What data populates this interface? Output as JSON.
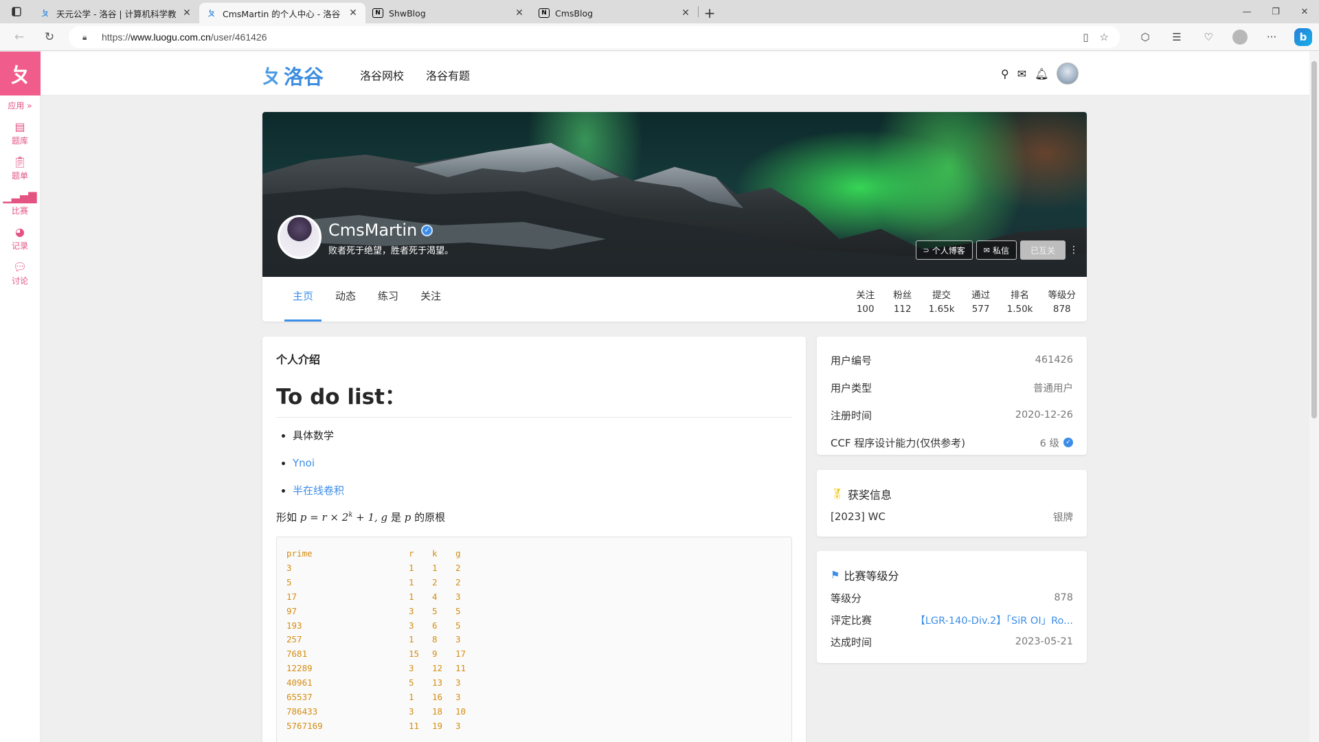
{
  "browser": {
    "tabs": [
      {
        "title": "天元公学 - 洛谷 | 计算机科学教",
        "favicon": "luogu",
        "active": false
      },
      {
        "title": "CmsMartin 的个人中心 - 洛谷",
        "favicon": "luogu",
        "active": true
      },
      {
        "title": "ShwBlog",
        "favicon": "N",
        "active": false
      },
      {
        "title": "CmsBlog",
        "favicon": "N",
        "active": false
      }
    ],
    "url_prefix": "https://",
    "url_host": "www.luogu.com.cn",
    "url_path": "/user/461426"
  },
  "sidenav": {
    "apps_label": "应用",
    "items": [
      {
        "label": "题库",
        "icon": "book-icon"
      },
      {
        "label": "题单",
        "icon": "clipboard-icon"
      },
      {
        "label": "比赛",
        "icon": "bar-chart-icon"
      },
      {
        "label": "记录",
        "icon": "pie-chart-icon"
      },
      {
        "label": "讨论",
        "icon": "chat-icon"
      }
    ]
  },
  "header": {
    "logo_text": "洛谷",
    "nav": [
      "洛谷网校",
      "洛谷有题"
    ]
  },
  "profile": {
    "name": "CmsMartin",
    "slogan": "败者死于绝望，胜者死于渴望。",
    "buttons": {
      "blog": "个人博客",
      "message": "私信",
      "follow": "已互关"
    },
    "tabs": [
      "主页",
      "动态",
      "练习",
      "关注"
    ],
    "active_tab": "主页",
    "stats": [
      {
        "label": "关注",
        "value": "100"
      },
      {
        "label": "粉丝",
        "value": "112"
      },
      {
        "label": "提交",
        "value": "1.65k"
      },
      {
        "label": "通过",
        "value": "577"
      },
      {
        "label": "排名",
        "value": "1.50k"
      },
      {
        "label": "等级分",
        "value": "878"
      }
    ]
  },
  "intro": {
    "title": "个人介绍",
    "heading": "To do list：",
    "list": [
      {
        "text": "具体数学",
        "link": false
      },
      {
        "text": "Ynoi",
        "link": true
      },
      {
        "text": "半在线卷积",
        "link": true
      }
    ],
    "formula_prefix": "形如 ",
    "formula_math": "p = r × 2",
    "formula_exp": "k",
    "formula_tail": " + 1, g",
    "formula_mid": " 是 ",
    "formula_p": "p",
    "formula_suffix": " 的原根",
    "code_header": [
      "prime",
      "r",
      "k",
      "g"
    ],
    "code_rows": [
      [
        "3",
        "1",
        "1",
        "2"
      ],
      [
        "5",
        "1",
        "2",
        "2"
      ],
      [
        "17",
        "1",
        "4",
        "3"
      ],
      [
        "97",
        "3",
        "5",
        "5"
      ],
      [
        "193",
        "3",
        "6",
        "5"
      ],
      [
        "257",
        "1",
        "8",
        "3"
      ],
      [
        "7681",
        "15",
        "9",
        "17"
      ],
      [
        "12289",
        "3",
        "12",
        "11"
      ],
      [
        "40961",
        "5",
        "13",
        "3"
      ],
      [
        "65537",
        "1",
        "16",
        "3"
      ],
      [
        "786433",
        "3",
        "18",
        "10"
      ],
      [
        "5767169",
        "11",
        "19",
        "3"
      ]
    ]
  },
  "info": [
    {
      "key": "用户编号",
      "value": "461426"
    },
    {
      "key": "用户类型",
      "value": "普通用户"
    },
    {
      "key": "注册时间",
      "value": "2020-12-26"
    },
    {
      "key": "CCF 程序设计能力(仅供参考)",
      "value": "6 级"
    }
  ],
  "awards": {
    "title": "获奖信息",
    "items": [
      {
        "key": "[2023] WC",
        "value": "银牌"
      }
    ]
  },
  "rating": {
    "title": "比赛等级分",
    "rows": [
      {
        "key": "等级分",
        "value": "878"
      },
      {
        "key": "评定比赛",
        "value": "【LGR-140-Div.2】「SiR OI」Ro..."
      },
      {
        "key": "达成时间",
        "value": "2023-05-21"
      }
    ]
  }
}
